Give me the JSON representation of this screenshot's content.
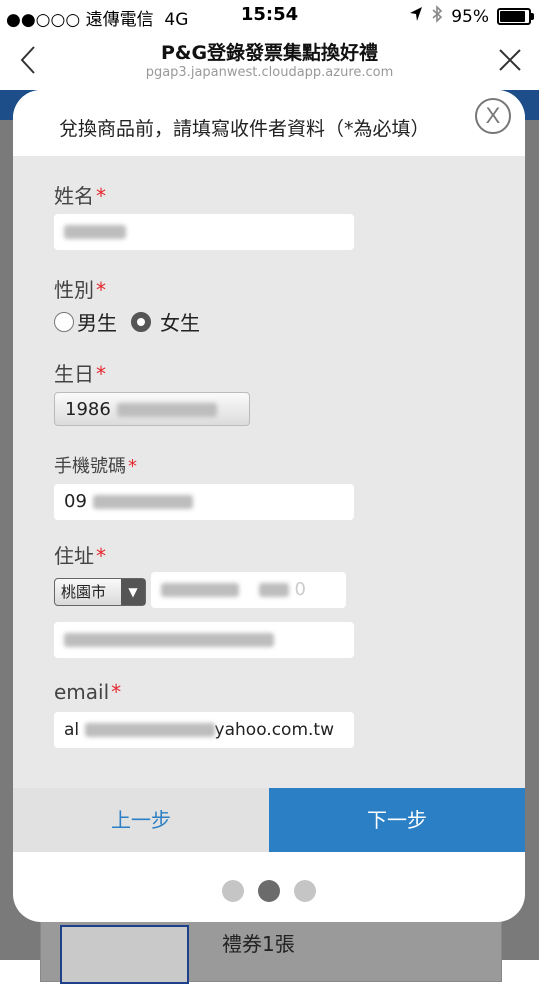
{
  "status_bar": {
    "carrier": "●●○○○ 遠傳電信",
    "network": "4G",
    "time": "15:54",
    "battery": "95%",
    "battery_level": 0.95
  },
  "browser": {
    "title": "P&G登錄發票集點換好禮",
    "url": "pgap3.japanwest.cloudapp.azure.com"
  },
  "modal": {
    "prompt": "兌換商品前，請填寫收件者資料（*為必填）",
    "close_glyph": "X",
    "fields": {
      "name": {
        "label": "姓名",
        "required": "*"
      },
      "gender": {
        "label": "性別",
        "required": "*",
        "options": [
          "男生",
          "女生"
        ],
        "selected": "女生"
      },
      "birthday": {
        "label": "生日",
        "required": "*",
        "value_visible": "1986"
      },
      "mobile": {
        "label": "手機號碼",
        "required": "*",
        "value_visible": "09"
      },
      "address": {
        "label": "住址",
        "required": "*",
        "city": "桃園市",
        "district_visible": "0"
      },
      "email": {
        "label": "email",
        "required": "*",
        "value_prefix": "al",
        "value_suffix": "yahoo.com.tw"
      }
    },
    "buttons": {
      "prev": "上一步",
      "next": "下一步"
    }
  },
  "background_page": {
    "coupon_text": "禮券1張"
  },
  "colors": {
    "accent": "#2b7fc4",
    "required": "#e4282e",
    "form_bg": "#e8e8e8"
  }
}
